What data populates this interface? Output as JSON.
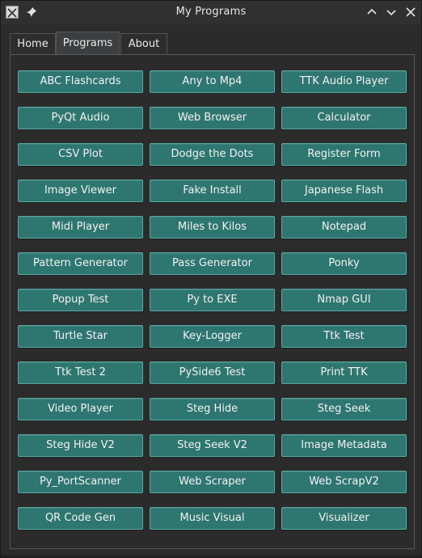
{
  "window": {
    "title": "My Programs",
    "icons": [
      "app-icon",
      "pin-icon",
      "chevron-up-icon",
      "chevron-down-icon",
      "close-icon"
    ]
  },
  "tabs": [
    {
      "label": "Home",
      "active": false
    },
    {
      "label": "Programs",
      "active": true
    },
    {
      "label": "About",
      "active": false
    }
  ],
  "programs": [
    "ABC Flashcards",
    "Any to Mp4",
    "TTK Audio Player",
    "PyQt Audio",
    "Web Browser",
    "Calculator",
    "CSV Plot",
    "Dodge the Dots",
    "Register Form",
    "Image Viewer",
    "Fake Install",
    "Japanese Flash",
    "Midi Player",
    "Miles to Kilos",
    "Notepad",
    "Pattern Generator",
    "Pass Generator",
    "Ponky",
    "Popup Test",
    "Py to EXE",
    "Nmap GUI",
    "Turtle Star",
    "Key-Logger",
    "Ttk Test",
    "Ttk Test 2",
    "PySide6 Test",
    "Print TTK",
    "Video Player",
    "Steg Hide",
    "Steg Seek",
    "Steg Hide V2",
    "Steg Seek V2",
    "Image Metadata",
    "Py_PortScanner",
    "Web Scraper",
    "Web ScrapV2",
    "QR Code Gen",
    "Music Visual",
    "Visualizer"
  ],
  "colors": {
    "button_bg": "#2e7670",
    "button_border": "#5aa9a2",
    "window_bg": "#2b2b2b"
  }
}
